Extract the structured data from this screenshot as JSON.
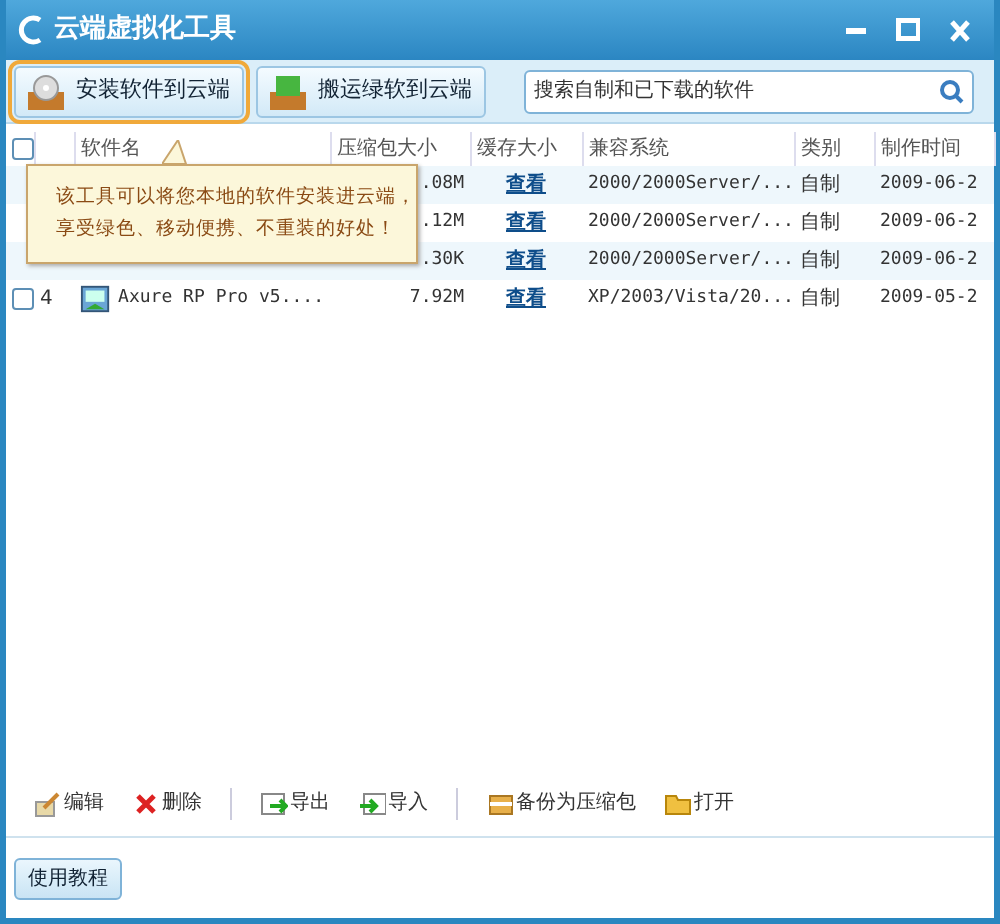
{
  "window": {
    "title": "云端虚拟化工具"
  },
  "toolbar": {
    "buttons": [
      {
        "label": "安装软件到云端",
        "kind": "disc",
        "selected": true
      },
      {
        "label": "搬运绿软到云端",
        "kind": "folder",
        "selected": false
      }
    ],
    "search": {
      "placeholder": "搜索自制和已下载的软件"
    }
  },
  "table": {
    "select_all": {
      "checked": false
    },
    "columns": [
      "软件名",
      "压缩包大小",
      "缓存大小",
      "兼容系统",
      "类别",
      "制作时间"
    ],
    "rows": [
      {
        "size": ".08M",
        "cache": "查看",
        "system": "2000/2000Server/...",
        "category": "自制",
        "time": "2009-06-2"
      },
      {
        "size": ".12M",
        "cache": "查看",
        "system": "2000/2000Server/...",
        "category": "自制",
        "time": "2009-06-2"
      },
      {
        "size": ".30K",
        "cache": "查看",
        "system": "2000/2000Server/...",
        "category": "自制",
        "time": "2009-06-2"
      },
      {
        "checked": false,
        "number": "4",
        "name": "Axure RP Pro v5....",
        "size": "7.92M",
        "cache": "查看",
        "system": "XP/2003/Vista/20...",
        "category": "自制",
        "time": "2009-05-2"
      }
    ]
  },
  "tooltip": {
    "lines": [
      "该工具可以将您本地的软件安装进云端，",
      "享受绿色、移动便携、不重装的好处！"
    ]
  },
  "actions": [
    [
      {
        "label": "编辑",
        "kind": "edit"
      },
      {
        "label": "删除",
        "kind": "delete"
      }
    ],
    [
      {
        "label": "导出",
        "kind": "export"
      },
      {
        "label": "导入",
        "kind": "import"
      }
    ],
    [
      {
        "label": "备份为压缩包",
        "kind": "backup"
      },
      {
        "label": "打开",
        "kind": "open"
      }
    ]
  ],
  "footer": {
    "button": "使用教程"
  }
}
